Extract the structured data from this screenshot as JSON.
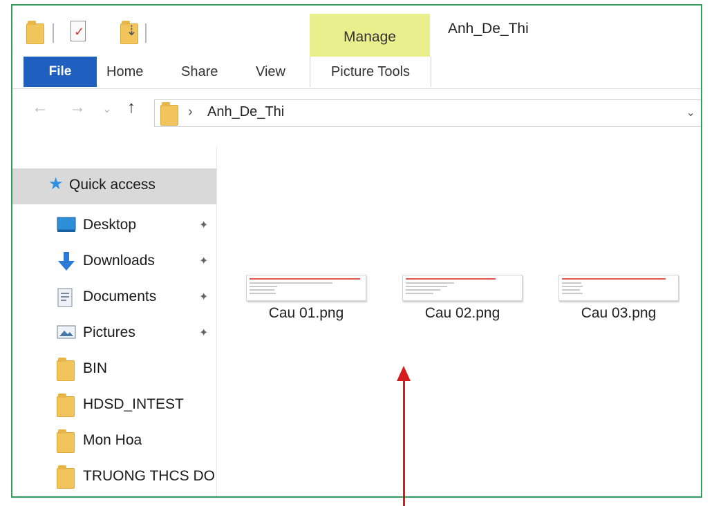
{
  "window": {
    "title": "Anh_De_Thi"
  },
  "ribbon": {
    "contextual_group": "Manage",
    "tabs": [
      {
        "label": "File"
      },
      {
        "label": "Home"
      },
      {
        "label": "Share"
      },
      {
        "label": "View"
      },
      {
        "label": "Picture Tools"
      }
    ]
  },
  "address": {
    "path": "Anh_De_Thi",
    "chevron": "›",
    "dropdown": "⌄"
  },
  "nav_buttons": {
    "back": "←",
    "forward": "→",
    "recent": "⌄",
    "up": "↑"
  },
  "nav_pane": {
    "items": [
      {
        "label": "Quick access",
        "icon": "star-icon",
        "pinned": false,
        "selected": true
      },
      {
        "label": "Desktop",
        "icon": "desktop-icon",
        "pinned": true
      },
      {
        "label": "Downloads",
        "icon": "download-arrow-icon",
        "pinned": true
      },
      {
        "label": "Documents",
        "icon": "document-icon",
        "pinned": true
      },
      {
        "label": "Pictures",
        "icon": "pictures-icon",
        "pinned": true
      },
      {
        "label": "BIN",
        "icon": "folder-icon",
        "pinned": false
      },
      {
        "label": "HDSD_INTEST",
        "icon": "folder-icon",
        "pinned": false
      },
      {
        "label": "Mon Hoa",
        "icon": "folder-icon",
        "pinned": false
      },
      {
        "label": "TRUONG THCS DOA",
        "icon": "folder-icon",
        "pinned": false
      }
    ],
    "pin_glyph": "✦"
  },
  "files": [
    {
      "name": "Cau 01.png",
      "icon": "image-thumbnail"
    },
    {
      "name": "Cau 02.png",
      "icon": "image-thumbnail"
    },
    {
      "name": "Cau 03.png",
      "icon": "image-thumbnail"
    }
  ],
  "colors": {
    "frame_border": "#2e9e5a",
    "file_tab": "#1f5fbf",
    "manage_tab": "#e9ef8c",
    "folder": "#f2c55c",
    "annotation_arrow": "#d51c1c"
  }
}
